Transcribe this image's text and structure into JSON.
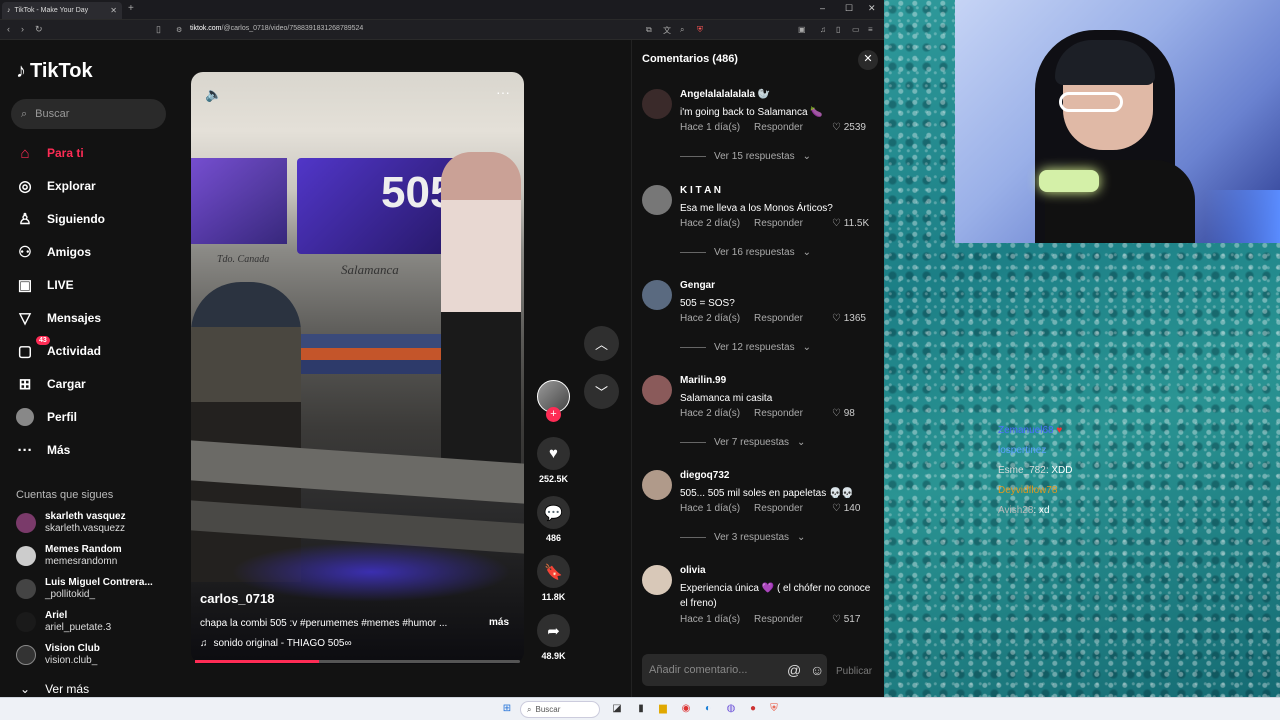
{
  "browser": {
    "tab_title": "TikTok - Make Your Day",
    "url_domain": "tiktok.com",
    "url_path": "/@carlos_0718/video/7588391831268789524"
  },
  "sidebar": {
    "logo": "TikTok",
    "search_placeholder": "Buscar",
    "nav": [
      {
        "label": "Para ti",
        "icon": "home-icon",
        "active": true
      },
      {
        "label": "Explorar",
        "icon": "compass-icon"
      },
      {
        "label": "Siguiendo",
        "icon": "following-icon"
      },
      {
        "label": "Amigos",
        "icon": "friends-icon"
      },
      {
        "label": "LIVE",
        "icon": "live-icon"
      },
      {
        "label": "Mensajes",
        "icon": "messages-icon"
      },
      {
        "label": "Actividad",
        "icon": "activity-icon",
        "badge": "43"
      },
      {
        "label": "Cargar",
        "icon": "upload-icon"
      },
      {
        "label": "Perfil",
        "icon": "profile-avatar"
      },
      {
        "label": "Más",
        "icon": "more-icon"
      }
    ],
    "following_title": "Cuentas que sigues",
    "following": [
      {
        "name": "skarleth vasquez",
        "username": "skarleth.vasquezz"
      },
      {
        "name": "Memes Random",
        "username": "memesrandomn"
      },
      {
        "name": "Luis Miguel Contrera...",
        "username": "_pollitokid_"
      },
      {
        "name": "Ariel",
        "username": "ariel_puetate.3"
      },
      {
        "name": "Vision Club",
        "username": "vision.club_"
      }
    ],
    "see_more": "Ver más"
  },
  "video": {
    "van_number": "505",
    "van_text_left": "Tdo. Canada",
    "van_text_right": "Salamanca",
    "author": "carlos_0718",
    "description": "chapa la combi 505 :v #perumemes #memes #humor ...",
    "more": "más",
    "music": "sonido original - THIAGO 505∞",
    "progress": 0.38
  },
  "actions": {
    "likes": "252.5K",
    "comments": "486",
    "saves": "11.8K",
    "shares": "48.9K"
  },
  "comments": {
    "title": "Comentarios (486)",
    "reply_label": "Responder",
    "items": [
      {
        "user": "Angelalalalalala 🦭",
        "text": "i'm going back to Salamanca 🍆",
        "time": "Hace 1 día(s)",
        "likes": "2539",
        "replies": "Ver 15 respuestas"
      },
      {
        "user": "K I T A N",
        "text": "Esa me lleva a los Monos Árticos?",
        "time": "Hace 2 día(s)",
        "likes": "11.5K",
        "replies": "Ver 16 respuestas"
      },
      {
        "user": "Gengar",
        "text": "505 = SOS?",
        "time": "Hace 2 día(s)",
        "likes": "1365",
        "replies": "Ver 12 respuestas"
      },
      {
        "user": "Marilin.99",
        "text": "Salamanca mi casita",
        "time": "Hace 2 día(s)",
        "likes": "98",
        "replies": "Ver 7 respuestas"
      },
      {
        "user": "diegoq732",
        "text": "505... 505 mil soles en papeletas 💀💀",
        "time": "Hace 1 día(s)",
        "likes": "140",
        "replies": "Ver 3 respuestas"
      },
      {
        "user": "olivia",
        "text": "Experiencia única 💜 ( el chófer no conoce el freno)",
        "time": "Hace 1 día(s)",
        "likes": "517",
        "replies": ""
      }
    ],
    "input_placeholder": "Añadir comentario...",
    "publish": "Publicar"
  },
  "chat": [
    {
      "user": "Zemanuel68",
      "msg": ""
    },
    {
      "user": "lospertinez",
      "msg": ""
    },
    {
      "user": "Esme_782",
      "msg": ": XDD"
    },
    {
      "user": "Deyvidflow78",
      "msg": ""
    },
    {
      "user": "Avish28",
      "msg": ": xd"
    }
  ],
  "taskbar": {
    "search_placeholder": "Buscar"
  },
  "colors": {
    "accent": "#fe2c55",
    "background": "#121212"
  }
}
